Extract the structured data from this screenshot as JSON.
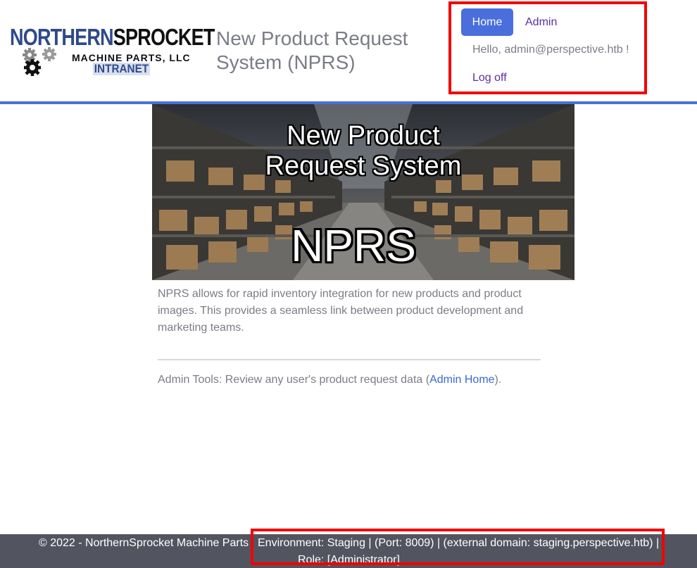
{
  "logo": {
    "brand_part1": "NORTHERN",
    "brand_part2": "SPROCKET",
    "subtitle": "MACHINE PARTS, LLC",
    "tag": "INTRANET",
    "icon": "gears-icon"
  },
  "header": {
    "title": "New Product Request System (NPRS)"
  },
  "nav": {
    "home": "Home",
    "admin": "Admin",
    "greeting": "Hello, admin@perspective.htb !",
    "logoff": "Log off"
  },
  "hero": {
    "title_line1": "New Product",
    "title_line2": "Request System",
    "big": "NPRS"
  },
  "main": {
    "description": "NPRS allows for rapid inventory integration for new products and product images. This provides a seamless link between product development and marketing teams.",
    "admin_tools_prefix": "Admin Tools: Review any user's product request data (",
    "admin_tools_link": "Admin Home",
    "admin_tools_suffix": ")."
  },
  "footer": {
    "copyright": "© 2022 - NorthernSprocket Machine Parts",
    "env_line1": "Environment: Staging | (Port: 8009) | (external domain: staging.perspective.htb) |",
    "env_line2": "Role: [Administrator]"
  },
  "colors": {
    "accent": "#4a6fdc",
    "highlight_box": "#f20000",
    "footer_bg": "#525560"
  }
}
